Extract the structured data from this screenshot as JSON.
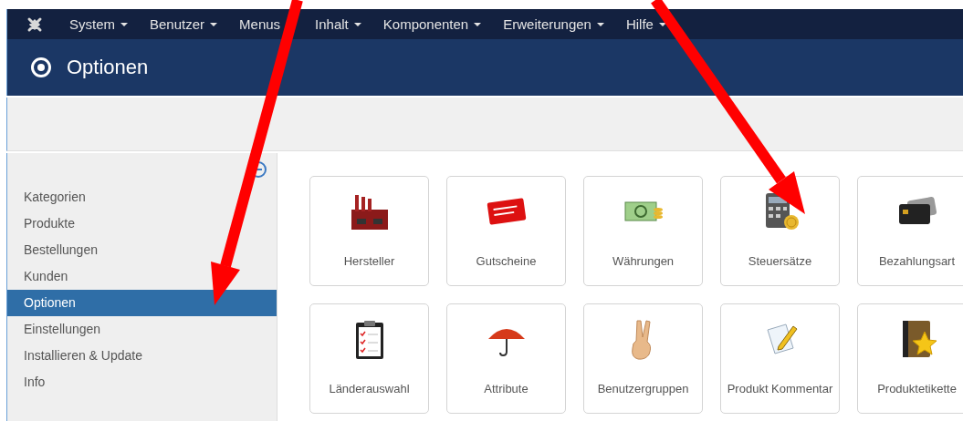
{
  "nav": {
    "items": [
      {
        "label": "System"
      },
      {
        "label": "Benutzer"
      },
      {
        "label": "Menus"
      },
      {
        "label": "Inhalt"
      },
      {
        "label": "Komponenten"
      },
      {
        "label": "Erweiterungen"
      },
      {
        "label": "Hilfe"
      }
    ]
  },
  "header": {
    "title": "Optionen"
  },
  "sidebar": {
    "items": [
      {
        "label": "Kategorien",
        "selected": false
      },
      {
        "label": "Produkte",
        "selected": false
      },
      {
        "label": "Bestellungen",
        "selected": false
      },
      {
        "label": "Kunden",
        "selected": false
      },
      {
        "label": "Optionen",
        "selected": true
      },
      {
        "label": "Einstellungen",
        "selected": false
      },
      {
        "label": "Installieren & Update",
        "selected": false
      },
      {
        "label": "Info",
        "selected": false
      }
    ]
  },
  "tiles": [
    {
      "label": "Hersteller"
    },
    {
      "label": "Gutscheine"
    },
    {
      "label": "Währungen"
    },
    {
      "label": "Steuersätze"
    },
    {
      "label": "Bezahlungsart"
    },
    {
      "label": "Länderauswahl"
    },
    {
      "label": "Attribute"
    },
    {
      "label": "Benutzergruppen"
    },
    {
      "label": "Produkt Kommentar"
    },
    {
      "label": "Produktetikette"
    }
  ]
}
